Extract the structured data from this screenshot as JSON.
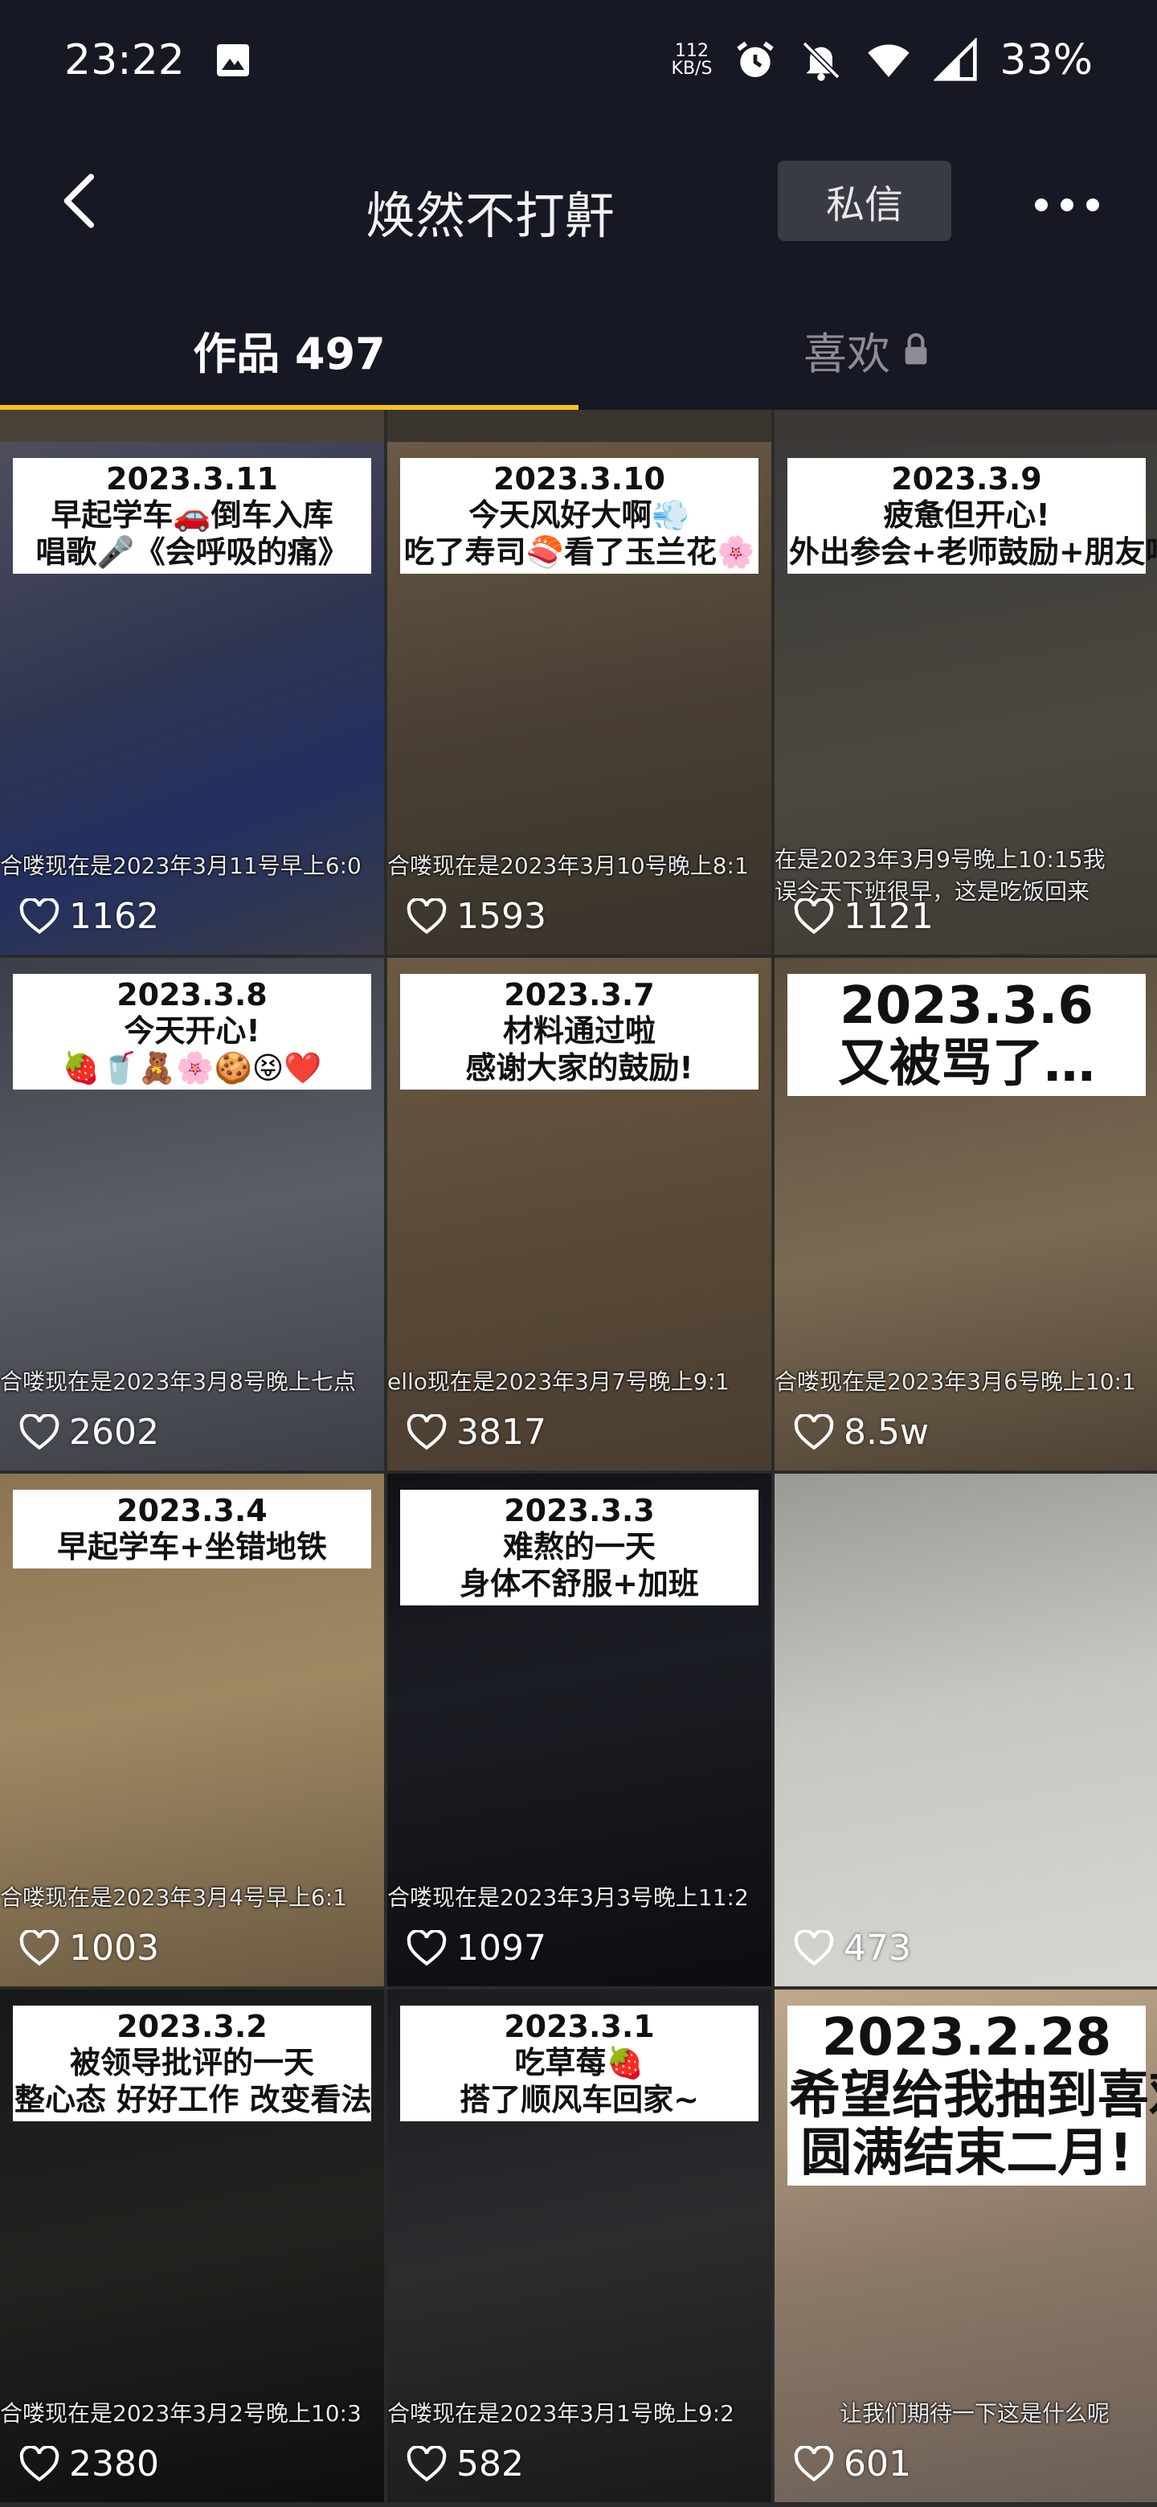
{
  "status": {
    "time": "23:22",
    "net_speed_top": "112",
    "net_speed_bottom": "KB/S",
    "battery": "33%",
    "icons": [
      "image-icon",
      "alarm-icon",
      "mute-icon",
      "wifi-icon",
      "signal-icon"
    ]
  },
  "header": {
    "title": "焕然不打鼾",
    "dm_label": "私信"
  },
  "tabs": {
    "works": "作品 497",
    "likes": "喜欢"
  },
  "colors": {
    "background": "#161823",
    "accent": "#f8c41a"
  },
  "tiles": [
    {
      "date": "2023.3.11",
      "line1": "早起学车🚗倒车入库",
      "line2": "唱歌🎤《会呼吸的痛》",
      "subtitle": "合喽现在是2023年3月11号早上6:0",
      "likes": "1162"
    },
    {
      "date": "2023.3.10",
      "line1": "今天风好大啊💨",
      "line2": "吃了寿司🍣看了玉兰花🌸",
      "subtitle": "合喽现在是2023年3月10号晚上8:1",
      "likes": "1593"
    },
    {
      "date": "2023.3.9",
      "line1": "疲惫但开心!",
      "line2": "外出参会+老师鼓励+朋友吃饭",
      "subtitle": "在是2023年3月9号晚上10:15我",
      "subtitle2": "误今天下班很早，这是吃饭回来",
      "likes": "1121"
    },
    {
      "date": "2023.3.8",
      "line1": "今天开心!",
      "line2": "🍓🥤🧸🌸🍪😝❤️",
      "subtitle": "合喽现在是2023年3月8号晚上七点",
      "likes": "2602"
    },
    {
      "date": "2023.3.7",
      "line1": "材料通过啦",
      "line2": "感谢大家的鼓励!",
      "subtitle": "ello现在是2023年3月7号晚上9:1",
      "likes": "3817"
    },
    {
      "date": "2023.3.6",
      "line1": "又被骂了…",
      "line2": "",
      "subtitle": "合喽现在是2023年3月6号晚上10:1",
      "likes": "8.5w"
    },
    {
      "date": "2023.3.4",
      "line1": "早起学车+坐错地铁",
      "line2": "",
      "subtitle": "合喽现在是2023年3月4号早上6:1",
      "likes": "1003"
    },
    {
      "date": "2023.3.3",
      "line1": "难熬的一天",
      "line2": "身体不舒服+加班",
      "subtitle": "合喽现在是2023年3月3号晚上11:2",
      "likes": "1097"
    },
    {
      "date": "",
      "line1": "",
      "line2": "",
      "subtitle": "",
      "likes": "473"
    },
    {
      "date": "2023.3.2",
      "line1": "被领导批评的一天",
      "line2": "整心态 好好工作 改变看法",
      "subtitle": "合喽现在是2023年3月2号晚上10:3",
      "likes": "2380"
    },
    {
      "date": "2023.3.1",
      "line1": "吃草莓🍓",
      "line2": "搭了顺风车回家~",
      "subtitle": "合喽现在是2023年3月1号晚上9:2",
      "likes": "582"
    },
    {
      "date": "2023.2.28",
      "line1": "希望给我抽到喜欢的盲",
      "line2": "圆满结束二月!",
      "subtitle": "让我们期待一下这是什么呢",
      "likes": "601"
    }
  ]
}
